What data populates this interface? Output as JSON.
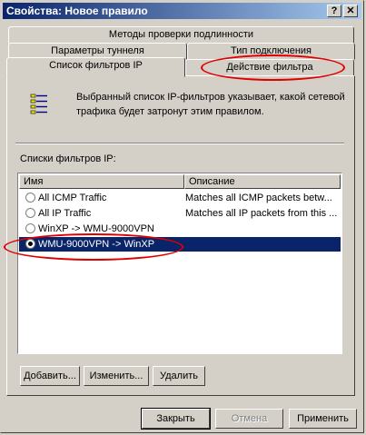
{
  "window": {
    "title": "Свойства: Новое правило",
    "help_label": "?",
    "close_label": "✕"
  },
  "tabs": {
    "row1": [
      "Методы проверки подлинности"
    ],
    "row2": [
      "Параметры туннеля",
      "Тип подключения"
    ],
    "row3": [
      "Список фильтров IP",
      "Действие фильтра"
    ]
  },
  "panel": {
    "description": "Выбранный список IP-фильтров указывает, какой сетевой трафика будет затронут этим правилом.",
    "list_label": "Списки фильтров IP:",
    "columns": [
      "Имя",
      "Описание"
    ],
    "rows": [
      {
        "name": "All ICMP Traffic",
        "desc": "Matches all ICMP packets betw...",
        "checked": false
      },
      {
        "name": "All IP Traffic",
        "desc": "Matches all IP packets from this ...",
        "checked": false
      },
      {
        "name": "WinXP -> WMU-9000VPN",
        "desc": "",
        "checked": false
      },
      {
        "name": "WMU-9000VPN -> WinXP",
        "desc": "",
        "checked": true
      }
    ],
    "buttons": {
      "add": "Добавить...",
      "edit": "Изменить...",
      "delete": "Удалить"
    }
  },
  "footer": {
    "close": "Закрыть",
    "cancel": "Отмена",
    "apply": "Применить"
  },
  "colors": {
    "selection": "#0a246a",
    "annotation": "#e00000"
  }
}
